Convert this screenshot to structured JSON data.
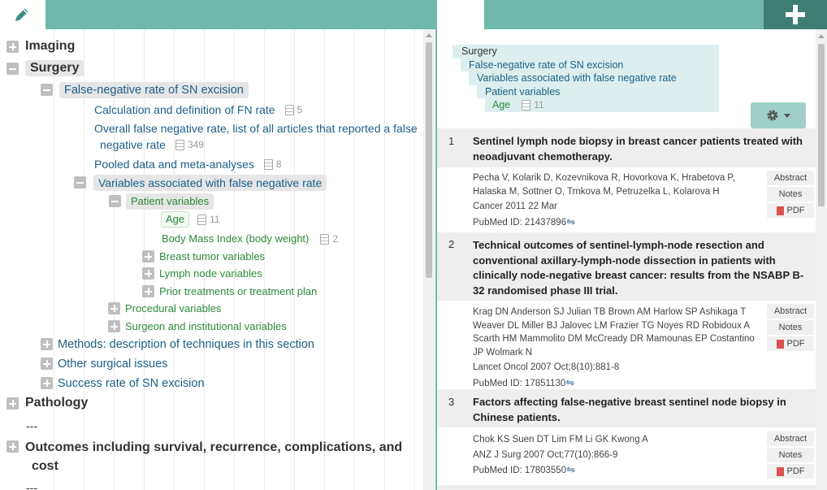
{
  "tree": {
    "imaging": "Imaging",
    "surgery": "Surgery",
    "fn_rate": "False-negative rate of SN excision",
    "calc": {
      "label": "Calculation and definition of FN rate",
      "count": "5"
    },
    "overall": {
      "label1": "Overall false negative rate, list of all articles that reported a false",
      "label2": "negative rate",
      "count": "349"
    },
    "pooled": {
      "label": "Pooled data and meta-analyses",
      "count": "8"
    },
    "variables": "Variables associated with false negative rate",
    "patient": "Patient variables",
    "age": {
      "label": "Age",
      "count": "11"
    },
    "bmi": {
      "label": "Body Mass Index (body weight)",
      "count": "2"
    },
    "breast_tumor": "Breast tumor variables",
    "lymph": "Lymph node variables",
    "prior": "Prior treatments or treatment plan",
    "procedural": "Procedural variables",
    "surgeon": "Surgeon and institutional variables",
    "methods": "Methods: description of techniques in this section",
    "other": "Other surgical issues",
    "success": "Success rate of SN excision",
    "pathology": "Pathology",
    "dash1": "---",
    "outcomes1": "Outcomes including survival, recurrence, complications, and",
    "outcomes2": "cost",
    "dash2": "---"
  },
  "breadcrumb": [
    "Surgery",
    "False-negative rate of SN excision",
    "Variables associated with false negative rate",
    "Patient variables"
  ],
  "breadcrumb_last": {
    "label": "Age",
    "count": "11"
  },
  "buttons": {
    "abstract": "Abstract",
    "notes": "Notes",
    "pdf": "PDF"
  },
  "results": [
    {
      "num": "1",
      "title": "Sentinel lymph node biopsy in breast cancer patients treated with neoadjuvant chemotherapy.",
      "authors": "Pecha V, Kolarik D, Kozevnikova R, Hovorkova K, Hrabetova P, Halaska M, Sottner O, Trnkova M, Petruzelka L, Kolarova H",
      "journal": "Cancer 2011 22 Mar",
      "pubmed": "PubMed ID: 21437896"
    },
    {
      "num": "2",
      "title": "Technical outcomes of sentinel-lymph-node resection and conventional axillary-lymph-node dissection in patients with clinically node-negative breast cancer: results from the NSABP B-32 randomised phase III trial.",
      "authors": "Krag DN Anderson SJ Julian TB Brown AM Harlow SP Ashikaga T Weaver DL Miller BJ Jalovec LM Frazier TG Noyes RD Robidoux A Scarth HM Mammolito DM McCready DR Mamounas EP Costantino JP Wolmark N",
      "journal": "Lancet Oncol 2007 Oct;8(10):881-8",
      "pubmed": "PubMed ID: 17851130"
    },
    {
      "num": "3",
      "title": "Factors affecting false-negative breast sentinel node biopsy in Chinese patients.",
      "authors": "Chok KS Suen DT Lim FM Li GK Kwong A",
      "journal": "ANZ J Surg 2007 Oct;77(10):866-9",
      "pubmed": "PubMed ID: 17803550"
    }
  ],
  "colors": {
    "teal": "#6fb8ab",
    "dark_teal": "#3e7d72",
    "link_blue": "#1c5f86",
    "green": "#2c8a3a"
  }
}
